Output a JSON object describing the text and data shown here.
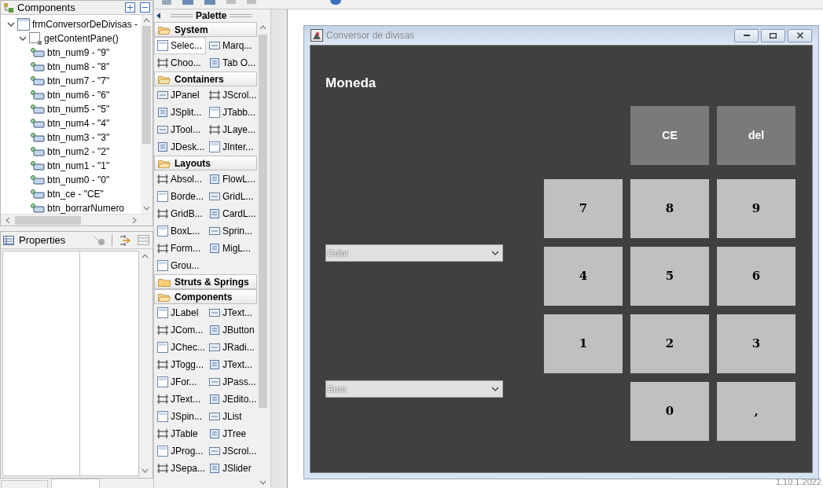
{
  "components_panel": {
    "title": "Components",
    "tree": [
      {
        "label": "frmConversorDeDivisas -",
        "expanded": true,
        "children": [
          {
            "label": "getContentPane()",
            "expanded": true,
            "children": [
              {
                "label": "btn_num9 - \"9\""
              },
              {
                "label": "btn_num8 - \"8\""
              },
              {
                "label": "btn_num7 - \"7\""
              },
              {
                "label": "btn_num6 - \"6\""
              },
              {
                "label": "btn_num5 - \"5\""
              },
              {
                "label": "btn_num4 - \"4\""
              },
              {
                "label": "btn_num3 - \"3\""
              },
              {
                "label": "btn_num2 - \"2\""
              },
              {
                "label": "btn_num1 - \"1\""
              },
              {
                "label": "btn_num0 - \"0\""
              },
              {
                "label": "btn_ce - \"CE\""
              },
              {
                "label": "btn_borrarNumero"
              }
            ]
          }
        ]
      }
    ]
  },
  "properties_panel": {
    "title": "Properties"
  },
  "palette": {
    "title": "Palette",
    "categories": [
      {
        "label": "System",
        "expanded": true,
        "items": [
          {
            "label": "Selec...",
            "selected": true
          },
          {
            "label": "Marq...",
            "selected": false
          },
          {
            "label": "Choo...",
            "selected": false
          },
          {
            "label": "Tab O...",
            "selected": false
          }
        ]
      },
      {
        "label": "Containers",
        "expanded": true,
        "items": [
          {
            "label": "JPanel",
            "selected": false
          },
          {
            "label": "JScrol...",
            "selected": false
          },
          {
            "label": "JSplit...",
            "selected": false
          },
          {
            "label": "JTabb...",
            "selected": false
          },
          {
            "label": "JTool...",
            "selected": false
          },
          {
            "label": "JLaye...",
            "selected": false
          },
          {
            "label": "JDesk...",
            "selected": false
          },
          {
            "label": "JInter...",
            "selected": false
          }
        ]
      },
      {
        "label": "Layouts",
        "expanded": true,
        "items": [
          {
            "label": "Absol...",
            "selected": false
          },
          {
            "label": "FlowL...",
            "selected": false
          },
          {
            "label": "Borde...",
            "selected": false
          },
          {
            "label": "GridL...",
            "selected": false
          },
          {
            "label": "GridB...",
            "selected": false
          },
          {
            "label": "CardL...",
            "selected": false
          },
          {
            "label": "BoxL...",
            "selected": false
          },
          {
            "label": "Sprin...",
            "selected": false
          },
          {
            "label": "Form...",
            "selected": false
          },
          {
            "label": "MigL...",
            "selected": false
          },
          {
            "label": "Grou...",
            "selected": false
          }
        ]
      },
      {
        "label": "Struts & Springs",
        "expanded": false
      },
      {
        "label": "Components",
        "expanded": true,
        "items": [
          {
            "label": "JLabel",
            "selected": false
          },
          {
            "label": "JText...",
            "selected": false
          },
          {
            "label": "JCom...",
            "selected": false
          },
          {
            "label": "JButton",
            "selected": false
          },
          {
            "label": "JChec...",
            "selected": false
          },
          {
            "label": "JRadi...",
            "selected": false
          },
          {
            "label": "JTogg...",
            "selected": false
          },
          {
            "label": "JText...",
            "selected": false
          },
          {
            "label": "JFor...",
            "selected": false
          },
          {
            "label": "JPass...",
            "selected": false
          },
          {
            "label": "JText...",
            "selected": false
          },
          {
            "label": "JEdito...",
            "selected": false
          },
          {
            "label": "JSpin...",
            "selected": false
          },
          {
            "label": "JList",
            "selected": false
          },
          {
            "label": "JTable",
            "selected": false
          },
          {
            "label": "JTree",
            "selected": false
          },
          {
            "label": "JProg...",
            "selected": false
          },
          {
            "label": "JScrol...",
            "selected": false
          },
          {
            "label": "JSepa...",
            "selected": false
          },
          {
            "label": "JSlider",
            "selected": false
          }
        ]
      }
    ]
  },
  "frame": {
    "title": "Conversor de divisas",
    "heading": "Moneda",
    "combos": [
      {
        "value": "Dolar"
      },
      {
        "value": "Euro"
      }
    ],
    "keys": [
      "CE",
      "del",
      "7",
      "8",
      "9",
      "4",
      "5",
      "6",
      "1",
      "2",
      "3",
      "0",
      ","
    ]
  },
  "version": "1.10.1.2022"
}
